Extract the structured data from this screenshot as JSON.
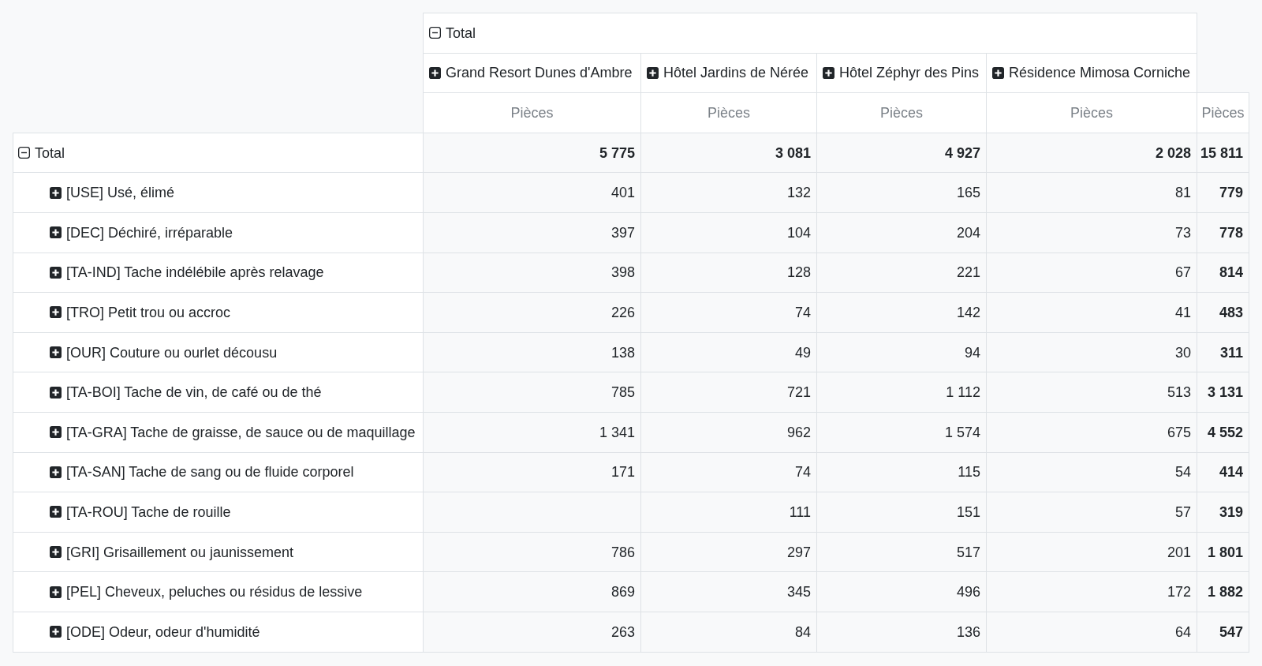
{
  "pivot": {
    "column_header": {
      "label": "Total",
      "expanded": true,
      "children": [
        {
          "label": "Grand Resort Dunes d'Ambre",
          "expanded": false
        },
        {
          "label": "Hôtel Jardins de Nérée",
          "expanded": false
        },
        {
          "label": "Hôtel Zéphyr des Pins",
          "expanded": false
        },
        {
          "label": "Résidence Mimosa Corniche",
          "expanded": false
        }
      ]
    },
    "measures": [
      "Pièces",
      "Pièces",
      "Pièces",
      "Pièces",
      "Pièces"
    ],
    "rows": {
      "label": "Total",
      "expanded": true,
      "cells": [
        {
          "value": "5 775",
          "blank": false
        },
        {
          "value": "3 081",
          "blank": false
        },
        {
          "value": "4 927",
          "blank": false
        },
        {
          "value": "2 028",
          "blank": false
        }
      ],
      "total": "15 811",
      "children": [
        {
          "label": "[USE] Usé, élimé",
          "expanded": false,
          "cells": [
            {
              "value": "401",
              "blank": false
            },
            {
              "value": "132",
              "blank": false
            },
            {
              "value": "165",
              "blank": false
            },
            {
              "value": "81",
              "blank": false
            }
          ],
          "total": "779"
        },
        {
          "label": "[DEC] Déchiré, irréparable",
          "expanded": false,
          "cells": [
            {
              "value": "397",
              "blank": false
            },
            {
              "value": "104",
              "blank": false
            },
            {
              "value": "204",
              "blank": false
            },
            {
              "value": "73",
              "blank": false
            }
          ],
          "total": "778"
        },
        {
          "label": "[TA-IND] Tache indélébile après relavage",
          "expanded": false,
          "cells": [
            {
              "value": "398",
              "blank": false
            },
            {
              "value": "128",
              "blank": false
            },
            {
              "value": "221",
              "blank": false
            },
            {
              "value": "67",
              "blank": false
            }
          ],
          "total": "814"
        },
        {
          "label": "[TRO] Petit trou ou accroc",
          "expanded": false,
          "cells": [
            {
              "value": "226",
              "blank": false
            },
            {
              "value": "74",
              "blank": false
            },
            {
              "value": "142",
              "blank": false
            },
            {
              "value": "41",
              "blank": false
            }
          ],
          "total": "483"
        },
        {
          "label": "[OUR] Couture ou ourlet décousu",
          "expanded": false,
          "cells": [
            {
              "value": "138",
              "blank": false
            },
            {
              "value": "49",
              "blank": false
            },
            {
              "value": "94",
              "blank": false
            },
            {
              "value": "30",
              "blank": false
            }
          ],
          "total": "311"
        },
        {
          "label": "[TA-BOI] Tache de vin, de café ou de thé",
          "expanded": false,
          "cells": [
            {
              "value": "785",
              "blank": false
            },
            {
              "value": "721",
              "blank": false
            },
            {
              "value": "1 112",
              "blank": false
            },
            {
              "value": "513",
              "blank": false
            }
          ],
          "total": "3 131"
        },
        {
          "label": "[TA-GRA] Tache de graisse, de sauce ou de maquillage",
          "expanded": false,
          "cells": [
            {
              "value": "1 341",
              "blank": false
            },
            {
              "value": "962",
              "blank": false
            },
            {
              "value": "1 574",
              "blank": false
            },
            {
              "value": "675",
              "blank": false
            }
          ],
          "total": "4 552"
        },
        {
          "label": "[TA-SAN] Tache de sang ou de fluide corporel",
          "expanded": false,
          "cells": [
            {
              "value": "171",
              "blank": false
            },
            {
              "value": "74",
              "blank": false
            },
            {
              "value": "115",
              "blank": false
            },
            {
              "value": "54",
              "blank": false
            }
          ],
          "total": "414"
        },
        {
          "label": "[TA-ROU] Tache de rouille",
          "expanded": false,
          "cells": [
            {
              "blank": true
            },
            {
              "value": "111",
              "blank": false
            },
            {
              "value": "151",
              "blank": false
            },
            {
              "value": "57",
              "blank": false
            }
          ],
          "total": "319"
        },
        {
          "label": "[GRI] Grisaillement ou jaunissement",
          "expanded": false,
          "cells": [
            {
              "value": "786",
              "blank": false
            },
            {
              "value": "297",
              "blank": false
            },
            {
              "value": "517",
              "blank": false
            },
            {
              "value": "201",
              "blank": false
            }
          ],
          "total": "1 801"
        },
        {
          "label": "[PEL] Cheveux, peluches ou résidus de lessive",
          "expanded": false,
          "cells": [
            {
              "value": "869",
              "blank": false
            },
            {
              "value": "345",
              "blank": false
            },
            {
              "value": "496",
              "blank": false
            },
            {
              "value": "172",
              "blank": false
            }
          ],
          "total": "1 882"
        },
        {
          "label": "[ODE] Odeur, odeur d'humidité",
          "expanded": false,
          "cells": [
            {
              "value": "263",
              "blank": false
            },
            {
              "value": "84",
              "blank": false
            },
            {
              "value": "136",
              "blank": false
            },
            {
              "value": "64",
              "blank": false
            }
          ],
          "total": "547"
        }
      ]
    }
  }
}
